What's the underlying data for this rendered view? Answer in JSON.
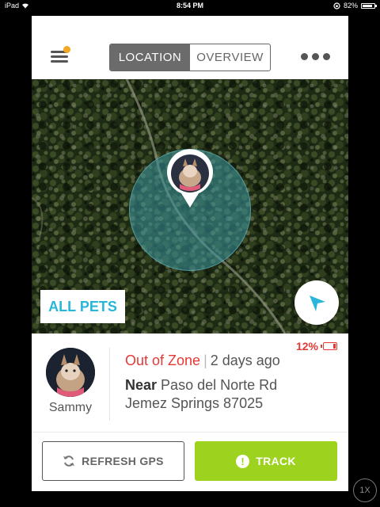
{
  "status_bar": {
    "device": "iPad",
    "time": "8:54 PM",
    "battery": "82%"
  },
  "header": {
    "tabs": [
      {
        "label": "LOCATION",
        "active": true
      },
      {
        "label": "OVERVIEW",
        "active": false
      }
    ]
  },
  "map": {
    "all_pets_label": "ALL PETS"
  },
  "pet": {
    "name": "Sammy",
    "status": "Out of Zone",
    "last_seen": "2 days ago",
    "near_label": "Near",
    "street": "Paso del Norte Rd",
    "city_zip": "Jemez Springs 87025",
    "battery_pct": "12%",
    "battery_level": 0.12
  },
  "footer": {
    "refresh_label": "REFRESH GPS",
    "track_label": "TRACK",
    "alert_glyph": "!"
  },
  "zoom_badge": "1X",
  "colors": {
    "track_green": "#9dd21e",
    "alert_red": "#e53935",
    "all_pets_blue": "#29b6d8",
    "zone_teal": "#3a96a0",
    "locate_blue": "#29b6d8",
    "menu_notification": "#f5a623"
  },
  "icons": {
    "menu": "hamburger-menu-icon",
    "more": "more-dots-icon",
    "locate": "location-arrow-icon",
    "refresh": "refresh-icon",
    "track": "alert-circle-icon",
    "battery": "battery-icon"
  }
}
